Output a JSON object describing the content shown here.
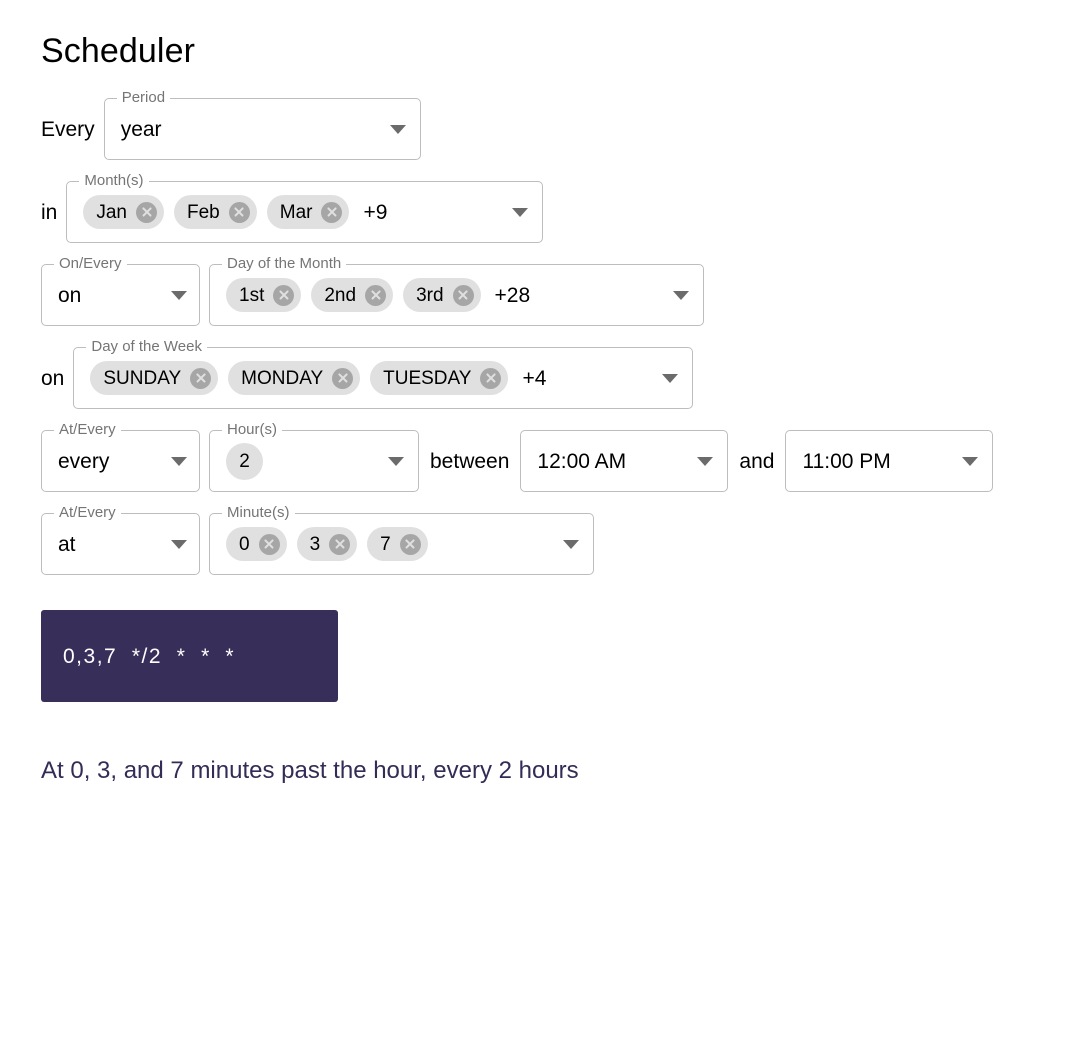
{
  "page": {
    "title": "Scheduler"
  },
  "connectors": {
    "every": "Every",
    "in": "in",
    "on_dom": "on",
    "on_dow": "on",
    "between": "between",
    "and": "and"
  },
  "period": {
    "label": "Period",
    "value": "year",
    "arrow_icon": "chevron-down-icon"
  },
  "months": {
    "label": "Month(s)",
    "chips": [
      {
        "text": "Jan",
        "remove_icon": "remove-chip-icon"
      },
      {
        "text": "Feb",
        "remove_icon": "remove-chip-icon"
      },
      {
        "text": "Mar",
        "remove_icon": "remove-chip-icon"
      }
    ],
    "overflow": "+9",
    "arrow_icon": "chevron-down-icon"
  },
  "day_of_month_mode": {
    "label": "On/Every",
    "value": "on",
    "arrow_icon": "chevron-down-icon"
  },
  "day_of_month": {
    "label": "Day of the Month",
    "chips": [
      {
        "text": "1st",
        "remove_icon": "remove-chip-icon"
      },
      {
        "text": "2nd",
        "remove_icon": "remove-chip-icon"
      },
      {
        "text": "3rd",
        "remove_icon": "remove-chip-icon"
      }
    ],
    "overflow": "+28",
    "arrow_icon": "chevron-down-icon"
  },
  "day_of_week": {
    "label": "Day of the Week",
    "chips": [
      {
        "text": "SUNDAY",
        "remove_icon": "remove-chip-icon"
      },
      {
        "text": "MONDAY",
        "remove_icon": "remove-chip-icon"
      },
      {
        "text": "TUESDAY",
        "remove_icon": "remove-chip-icon"
      }
    ],
    "overflow": "+4",
    "arrow_icon": "chevron-down-icon"
  },
  "hour_mode": {
    "label": "At/Every",
    "value": "every",
    "arrow_icon": "chevron-down-icon"
  },
  "hours": {
    "label": "Hour(s)",
    "chips": [
      {
        "text": "2"
      }
    ],
    "arrow_icon": "chevron-down-icon"
  },
  "time_start": {
    "value": "12:00 AM",
    "arrow_icon": "chevron-down-icon"
  },
  "time_end": {
    "value": "11:00 PM",
    "arrow_icon": "chevron-down-icon"
  },
  "minute_mode": {
    "label": "At/Every",
    "value": "at",
    "arrow_icon": "chevron-down-icon"
  },
  "minutes": {
    "label": "Minute(s)",
    "chips": [
      {
        "text": "0",
        "remove_icon": "remove-chip-icon"
      },
      {
        "text": "3",
        "remove_icon": "remove-chip-icon"
      },
      {
        "text": "7",
        "remove_icon": "remove-chip-icon"
      }
    ],
    "arrow_icon": "chevron-down-icon"
  },
  "cron": {
    "expression": "0,3,7  */2  *  *  *",
    "background_color": "#372f5a",
    "text_color": "#ffffff"
  },
  "description": {
    "text": "At 0, 3, and 7 minutes past the hour, every 2 hours",
    "color": "#322c57"
  }
}
